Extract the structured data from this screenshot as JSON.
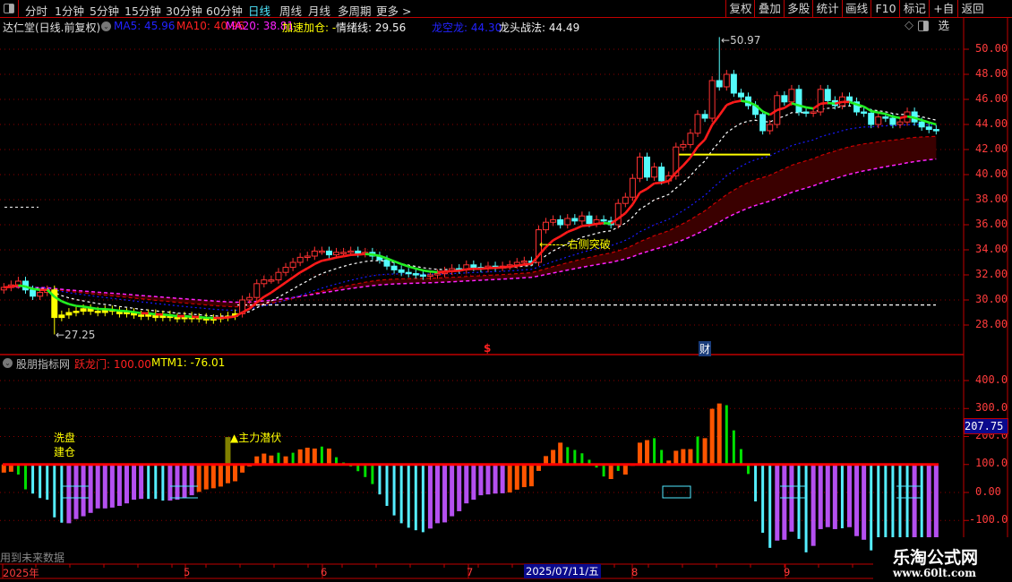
{
  "toolbar": {
    "left_items": [
      {
        "label": "分时",
        "active": false
      },
      {
        "label": "1分钟",
        "active": false
      },
      {
        "label": "5分钟",
        "active": false
      },
      {
        "label": "15分钟",
        "active": false
      },
      {
        "label": "30分钟",
        "active": false
      },
      {
        "label": "60分钟",
        "active": false
      },
      {
        "label": "日线",
        "active": true
      },
      {
        "label": "周线",
        "active": false
      },
      {
        "label": "月线",
        "active": false
      },
      {
        "label": "多周期",
        "active": false
      },
      {
        "label": "更多 >",
        "active": false
      }
    ],
    "right_buttons": [
      "复权",
      "叠加",
      "多股",
      "统计",
      "画线",
      "F10",
      "标记",
      "+自选",
      "返回"
    ]
  },
  "legend": {
    "stock": "达仁堂(日线.前复权)",
    "ma5": "MA5: 45.96",
    "ma10": "MA10: 40.96",
    "ma20": "MA20: 38.81",
    "accel": "加速加仓: -",
    "mood": "情绪线: 29.56",
    "dragon": "龙空龙: 44.30",
    "leader": "龙头战法: 44.49"
  },
  "indicator_legend": {
    "name": "股朋指标网",
    "jump": "跃龙门: 100.00",
    "mtm": "MTM1: -76.01"
  },
  "colors": {
    "up": "#ff3232",
    "down": "#54fcfc",
    "washout": "#ffff00",
    "ma_fast": "#ff1a1a",
    "ma_fast_falling": "#22ee22",
    "ma_mid": "#ffffff",
    "ma_slow": "#1a1aff",
    "ma_long": "#ff22ff",
    "band": "#3a0000",
    "hist": {
      "o": "#ff5500",
      "g": "#00e000",
      "c": "#55eeff",
      "p": "#b450f0"
    },
    "signal_bar": "#808000"
  },
  "price_axis": [
    "50.00",
    "48.00",
    "46.00",
    "44.00",
    "42.00",
    "40.00",
    "38.00",
    "36.00",
    "34.00",
    "32.00",
    "30.00",
    "28.00"
  ],
  "osc_axis": [
    "400.0",
    "300.0",
    "200.0",
    "100.0",
    "0.00",
    "-100.0"
  ],
  "osc_current": "207.75",
  "date_axis": {
    "labels": [
      {
        "text": "2025年"
      },
      {
        "text": "5"
      },
      {
        "text": "6"
      },
      {
        "text": "7"
      },
      {
        "text": "8"
      },
      {
        "text": "9"
      }
    ],
    "cursor_date": "2025/07/11/五"
  },
  "annotations": {
    "low": "27.25",
    "high": "50.97",
    "breakout": "右侧突破",
    "washout_1": "洗盘",
    "washout_2": "建仓",
    "lurk": "▲主力潜伏",
    "dollar": "$",
    "finance": "财",
    "future_data": "用到未来数据"
  },
  "watermark": {
    "title": "乐淘公式网",
    "url": "www.60lt.com"
  },
  "chart_data": [
    {
      "type": "candlestick",
      "ylim": [
        27,
        51
      ],
      "closes": [
        31.0,
        31.2,
        31.5,
        30.8,
        30.3,
        30.6,
        30.8,
        28.6,
        28.8,
        29.0,
        29.1,
        29.3,
        29.1,
        29.0,
        29.2,
        29.1,
        28.9,
        29.0,
        28.8,
        28.7,
        28.9,
        28.6,
        28.8,
        28.6,
        28.5,
        28.7,
        28.5,
        28.6,
        28.4,
        28.5,
        28.6,
        28.7,
        28.9,
        30.0,
        30.2,
        31.3,
        31.6,
        31.6,
        32.2,
        32.6,
        33.0,
        33.4,
        33.5,
        33.9,
        33.9,
        33.6,
        33.8,
        33.8,
        33.9,
        33.7,
        33.8,
        33.5,
        33.2,
        32.7,
        32.4,
        32.2,
        32.1,
        32.0,
        31.9,
        32.0,
        32.1,
        32.3,
        32.5,
        32.4,
        32.8,
        32.6,
        32.5,
        32.7,
        32.6,
        32.7,
        32.8,
        33.0,
        33.1,
        33.0,
        35.6,
        36.2,
        36.4,
        36.0,
        36.5,
        36.3,
        36.7,
        36.1,
        36.4,
        36.3,
        36.0,
        37.7,
        38.2,
        39.7,
        41.4,
        39.8,
        40.6,
        39.5,
        39.9,
        42.2,
        42.4,
        43.3,
        44.8,
        44.5,
        47.5,
        47.0,
        48.0,
        46.5,
        46.2,
        45.5,
        44.8,
        43.5,
        44.0,
        46.3,
        45.8,
        46.8,
        45.0,
        44.9,
        45.0,
        46.8,
        45.9,
        45.5,
        46.2,
        45.8,
        45.0,
        44.9,
        44.0,
        44.6,
        44.5,
        44.0,
        44.2,
        45.0,
        44.2,
        43.8,
        43.6,
        43.5
      ],
      "period_low": 27.25,
      "period_high": 50.97,
      "hlines": [
        {
          "price": 37.4,
          "color": "#ffffff"
        },
        {
          "price": 29.6,
          "color": "#ffffff"
        },
        {
          "price": 41.6,
          "color": "#ffff00"
        }
      ]
    },
    {
      "type": "bar",
      "baseline": 100,
      "ylim": [
        -220,
        460
      ],
      "values": [
        71,
        74,
        64,
        11,
        -4,
        -20,
        -26,
        -89,
        -108,
        -110,
        -95,
        -85,
        -73,
        -57,
        -57,
        -54,
        -48,
        -39,
        -26,
        -23,
        -23,
        -23,
        -29,
        -29,
        -26,
        -20,
        -10,
        2,
        11,
        15,
        21,
        33,
        40,
        71,
        93,
        129,
        139,
        132,
        142,
        129,
        142,
        154,
        160,
        157,
        164,
        157,
        126,
        107,
        93,
        76,
        55,
        30,
        -7,
        -48,
        -82,
        -110,
        -126,
        -135,
        -142,
        -129,
        -110,
        -107,
        -85,
        -67,
        -39,
        -26,
        -10,
        -7,
        -4,
        -3,
        0,
        10,
        19,
        22,
        77,
        130,
        152,
        178,
        162,
        152,
        140,
        117,
        89,
        57,
        48,
        77,
        64,
        96,
        178,
        187,
        194,
        152,
        114,
        149,
        155,
        155,
        200,
        194,
        299,
        318,
        312,
        222,
        155,
        66,
        -32,
        -144,
        -198,
        -172,
        -169,
        -140,
        -166,
        -214,
        -191,
        -131,
        -124,
        -131,
        -128,
        -124,
        -156,
        -169,
        -207,
        -160,
        -160,
        -160,
        -160,
        -160,
        -160,
        -160,
        -160,
        -160
      ],
      "colors": "ooggcccccpppppppppppcccppppooooooooooogogooogoggggggcccccccpppppppppppooooooooggggggogooooggoooogoooggggcccpppccppppcpppccccccpcppcpp",
      "signal_value": 198
    }
  ]
}
